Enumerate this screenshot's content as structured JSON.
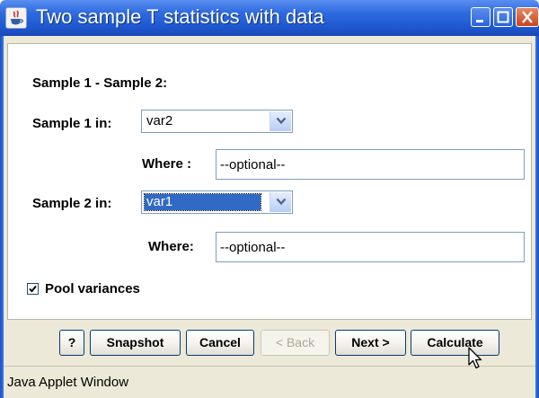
{
  "window": {
    "title": "Two sample T statistics with data",
    "controls": [
      "minimize-icon",
      "maximize-icon",
      "close-icon"
    ]
  },
  "form": {
    "section_label": "Sample 1 - Sample 2:",
    "sample1": {
      "label": "Sample 1 in:",
      "selected": "var2",
      "where_label": "Where :",
      "where_value": "--optional--"
    },
    "sample2": {
      "label": "Sample 2 in:",
      "selected": "var1",
      "where_label": "Where:",
      "where_value": "--optional--"
    },
    "pool": {
      "label": "Pool variances",
      "checked": true
    }
  },
  "buttons": {
    "help": "?",
    "snapshot": "Snapshot",
    "cancel": "Cancel",
    "back": "< Back",
    "next": "Next >",
    "calculate": "Calculate"
  },
  "status": {
    "text": "Java Applet Window"
  },
  "colors": {
    "titlebar": "#2f6be0",
    "selection": "#316ac5",
    "window_bg": "#ece9d8"
  }
}
